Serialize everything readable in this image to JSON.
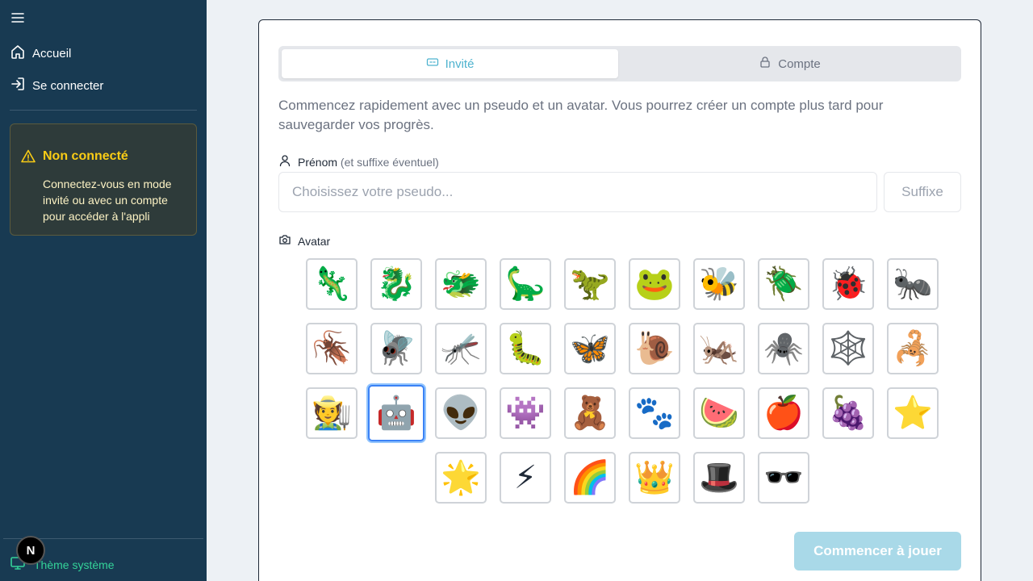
{
  "sidebar": {
    "nav": [
      {
        "label": "Accueil",
        "icon": "home-icon"
      },
      {
        "label": "Se connecter",
        "icon": "login-icon"
      }
    ],
    "warning": {
      "title": "Non connecté",
      "text": "Connectez-vous en mode invité ou avec un compte pour accéder à l'appli"
    },
    "theme_label": "Thème système",
    "badge_letter": "N"
  },
  "tabs": {
    "guest_label": "Invité",
    "account_label": "Compte",
    "active": "guest"
  },
  "intro_text": "Commencez rapidement avec un pseudo et un avatar. Vous pourrez créer un compte plus tard pour sauvegarder vos progrès.",
  "name_field": {
    "label": "Prénom",
    "hint": "(et suffixe éventuel)",
    "placeholder": "Choisissez votre pseudo...",
    "value": "",
    "suffix_placeholder": "Suffixe"
  },
  "avatar_field": {
    "label": "Avatar",
    "selected_index": 21,
    "rows": [
      [
        "🦎",
        "🐉",
        "🐲",
        "🦕",
        "🦖",
        "🐸",
        "🐝",
        "🪲",
        "🐞",
        "🐜"
      ],
      [
        "🪳",
        "🪰",
        "🦟",
        "🐛",
        "🦋",
        "🐌",
        "🦗",
        "🕷️",
        "🕸️",
        "🦂"
      ],
      [
        "🧑‍🌾",
        "🤖",
        "👽",
        "👾",
        "🧸",
        "🐾",
        "🍉",
        "🍎",
        "🍇",
        "⭐"
      ],
      [
        "🌟",
        "⚡",
        "🌈",
        "👑",
        "🎩",
        "🕶️"
      ]
    ]
  },
  "start_button_label": "Commencer à jouer",
  "colors": {
    "sidebar_bg": "#183a52",
    "accent": "#4fb3cf",
    "warning": "#facc15",
    "theme": "#34d399",
    "start_button_disabled": "#a9d9e8"
  }
}
